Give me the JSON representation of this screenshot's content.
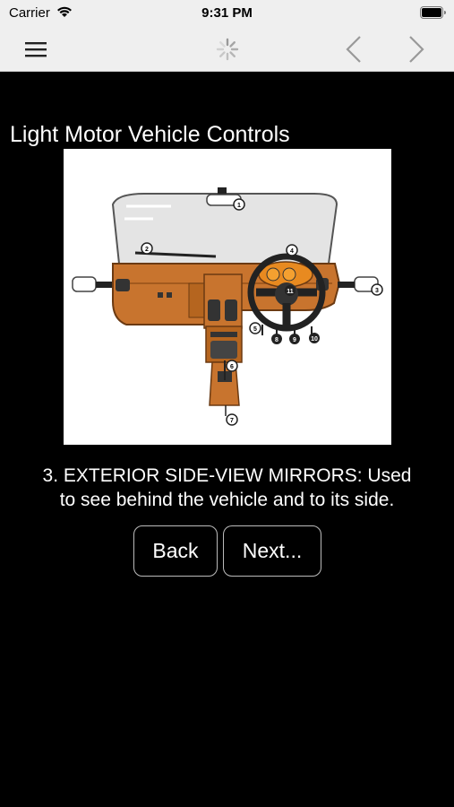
{
  "status_bar": {
    "carrier": "Carrier",
    "time": "9:31 PM"
  },
  "nav_bar": {
    "icons": [
      "hamburger-menu-icon",
      "loading-spinner-icon",
      "back-arrow-icon",
      "forward-arrow-icon"
    ]
  },
  "main": {
    "title": "Light Motor Vehicle Controls",
    "description_line1": "3. EXTERIOR SIDE-VIEW MIRRORS: Used",
    "description_line2": "to see behind the vehicle and to its side.",
    "back_label": "Back",
    "next_label": "Next..."
  },
  "diagram": {
    "callouts": [
      "1",
      "2",
      "3",
      "3",
      "5",
      "6",
      "7",
      "8",
      "9",
      "10",
      "11",
      "5"
    ]
  },
  "colors": {
    "background": "#000000",
    "bar": "#efefef",
    "dashboard": "#c8742e"
  }
}
